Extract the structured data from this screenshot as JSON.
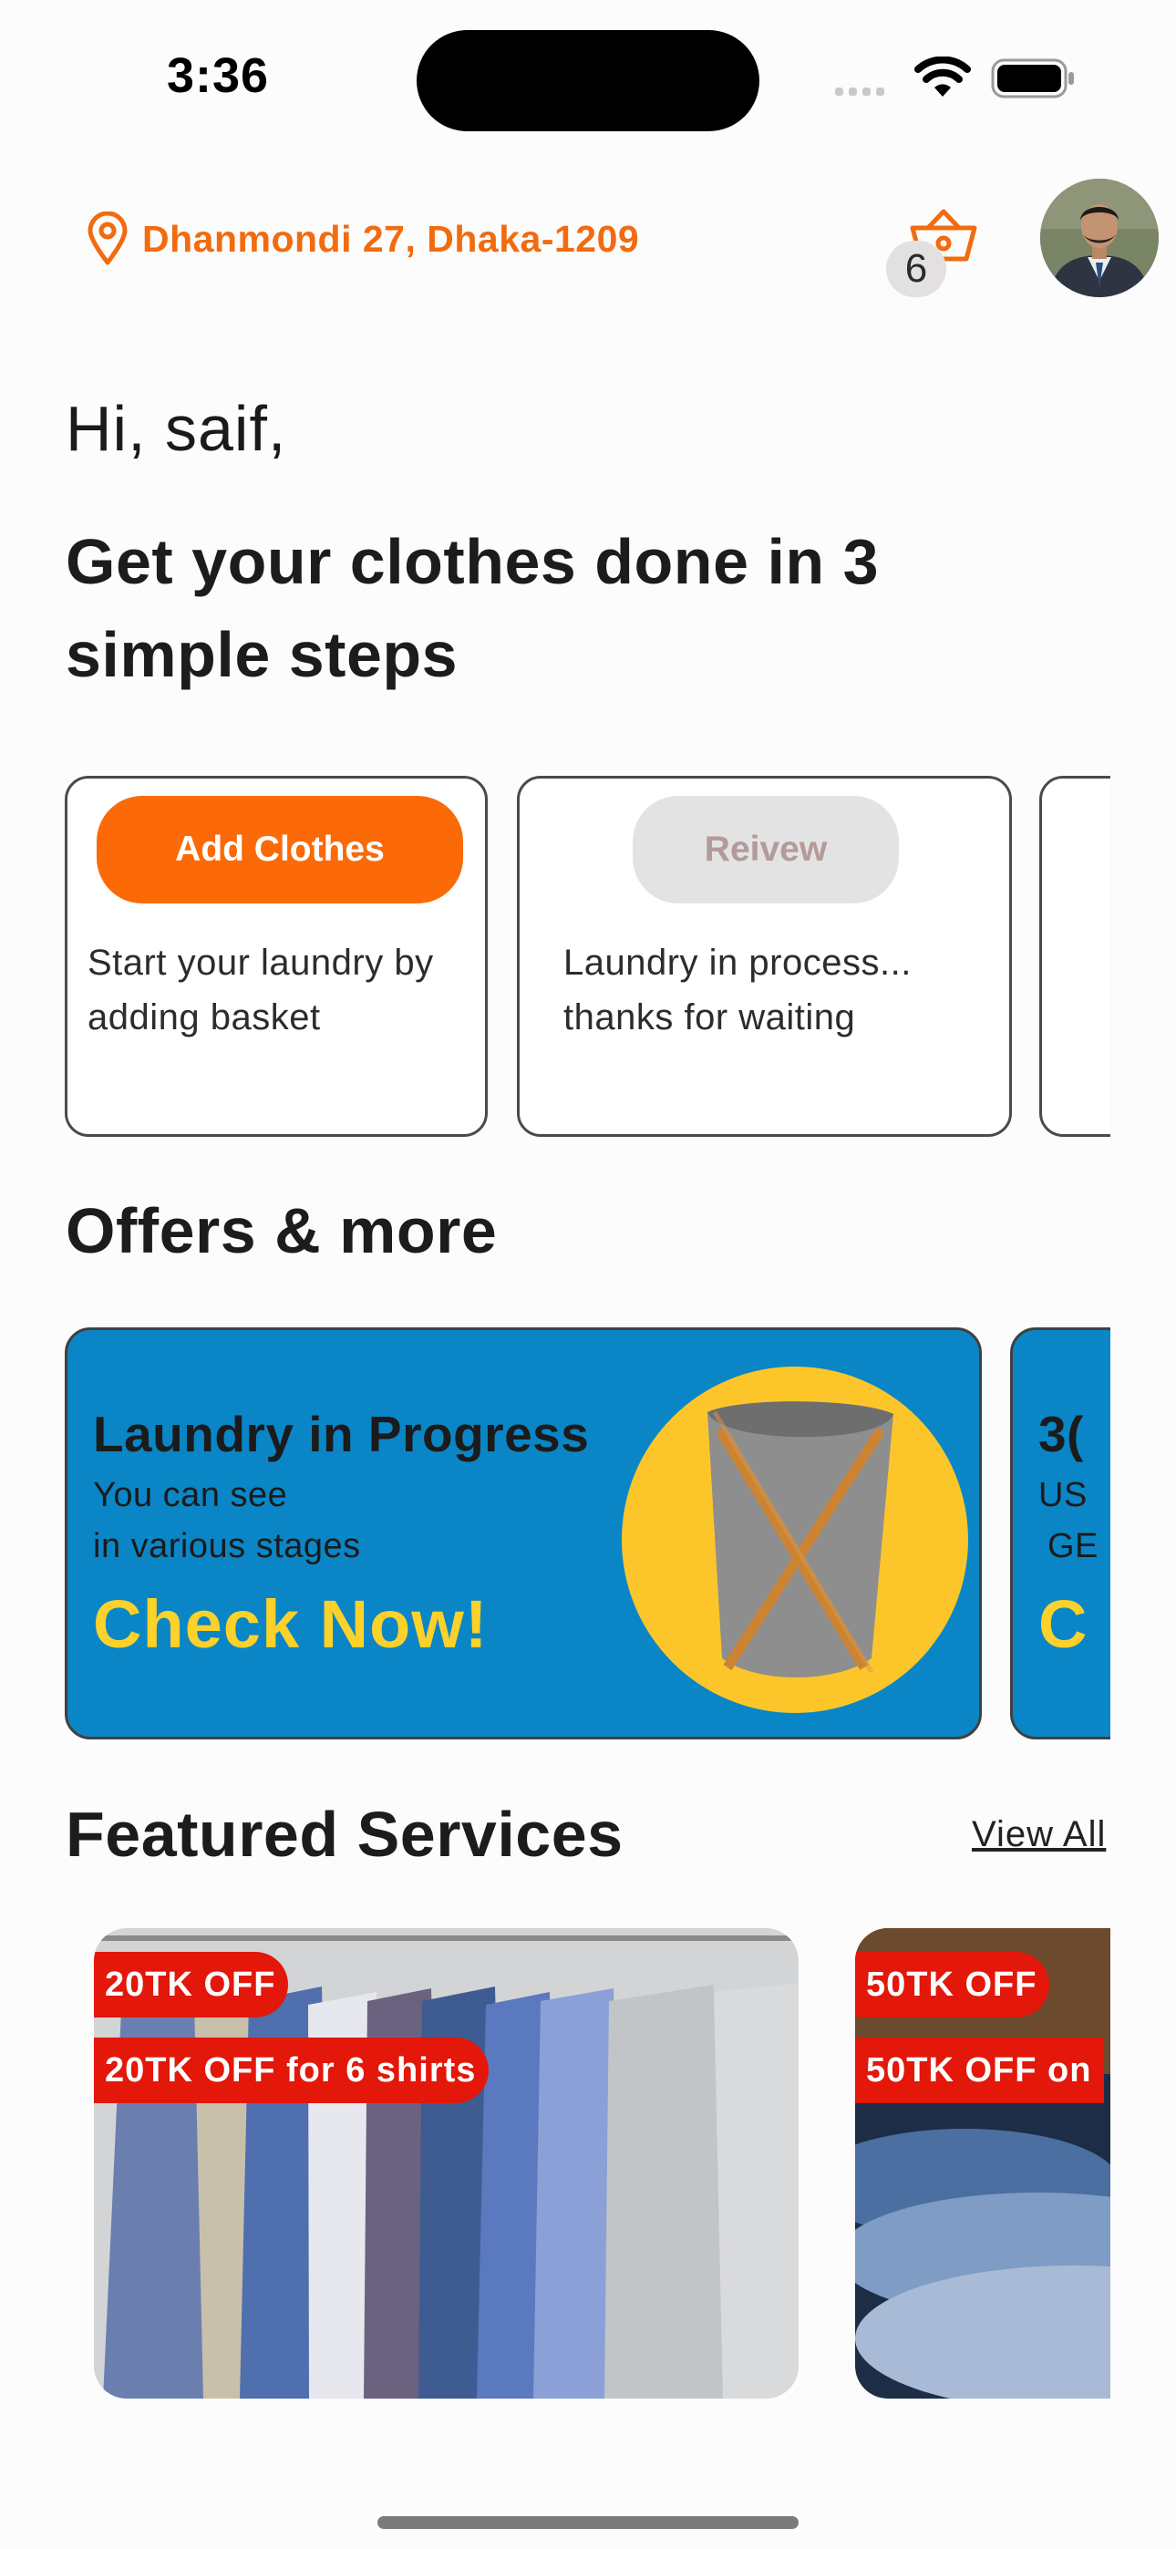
{
  "status_bar": {
    "time": "3:36"
  },
  "header": {
    "location": "Dhanmondi 27, Dhaka-1209",
    "cart_count": "6"
  },
  "greeting": "Hi, saif,",
  "headline": "Get your clothes done in 3 simple steps",
  "steps": [
    {
      "button": "Add Clothes",
      "text": "Start your laundry by adding basket"
    },
    {
      "button": "Reivew",
      "text": "Laundry in process... thanks for waiting"
    }
  ],
  "offers": {
    "title": "Offers & more",
    "cards": [
      {
        "title": "Laundry in Progress",
        "line1": "You can see",
        "line2": "in various stages",
        "cta": "Check Now!"
      },
      {
        "title": "3(",
        "line1": "US",
        "line2": "GE",
        "cta": "C"
      }
    ]
  },
  "featured": {
    "title": "Featured Services",
    "view_all": "View All",
    "items": [
      {
        "tag": "20TK OFF",
        "label": "20TK OFF for 6 shirts"
      },
      {
        "tag": "50TK OFF",
        "label": "50TK OFF on"
      }
    ]
  },
  "colors": {
    "accent": "#f26b0f",
    "offer_bg": "#0a86c6",
    "offer_cta": "#fcd12a",
    "tag_red": "#e3170a"
  }
}
